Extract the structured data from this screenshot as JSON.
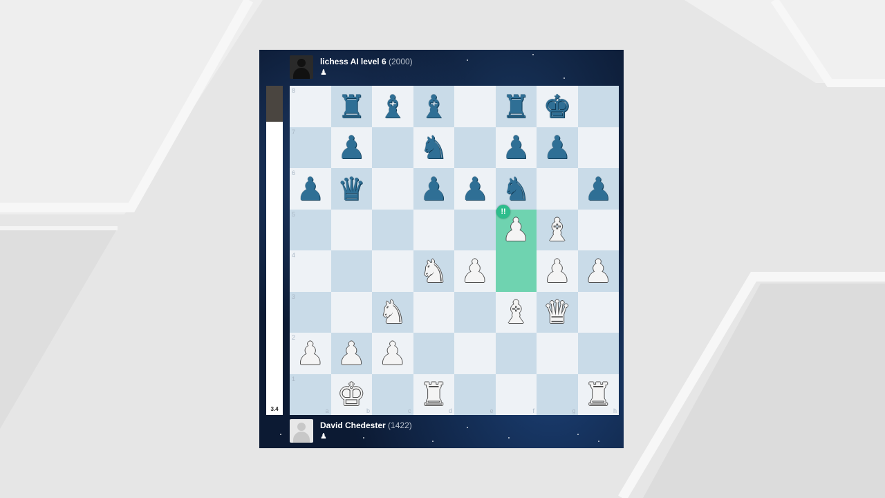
{
  "top_player": {
    "name": "lichess AI level 6",
    "rating": "(2000)",
    "icon": "pawn-icon"
  },
  "bottom_player": {
    "name": "David Chedester",
    "rating": "(1422)",
    "icon": "pawn-icon"
  },
  "eval": {
    "label": "3.4",
    "black_fraction": 0.11
  },
  "move_annotation": {
    "symbol": "!!",
    "square": "f5",
    "color": "#2dbd8c"
  },
  "highlight_squares": [
    "f5",
    "f4"
  ],
  "ranks": [
    "8",
    "7",
    "6",
    "5",
    "4",
    "3",
    "2",
    "1"
  ],
  "files": [
    "a",
    "b",
    "c",
    "d",
    "e",
    "f",
    "g",
    "h"
  ],
  "board": [
    [
      "",
      "bR",
      "bB",
      "bB",
      "",
      "bR",
      "bK",
      ""
    ],
    [
      "",
      "bP",
      "",
      "bN",
      "",
      "bP",
      "bP",
      ""
    ],
    [
      "bP",
      "bQ",
      "",
      "bP",
      "bP",
      "bN",
      "",
      "bP"
    ],
    [
      "",
      "",
      "",
      "",
      "",
      "wP",
      "wB",
      ""
    ],
    [
      "",
      "",
      "",
      "wN",
      "wP",
      "",
      "wP",
      "wP"
    ],
    [
      "",
      "",
      "wN",
      "",
      "",
      "wB",
      "wQ",
      ""
    ],
    [
      "wP",
      "wP",
      "wP",
      "",
      "",
      "",
      "",
      ""
    ],
    [
      "",
      "wK",
      "",
      "wR",
      "",
      "",
      "",
      "wR"
    ]
  ],
  "colors": {
    "light_square": "#eef2f6",
    "dark_square": "#c9dbe8",
    "black_piece": "#2f6f95",
    "highlight": "#6fd3b0"
  }
}
